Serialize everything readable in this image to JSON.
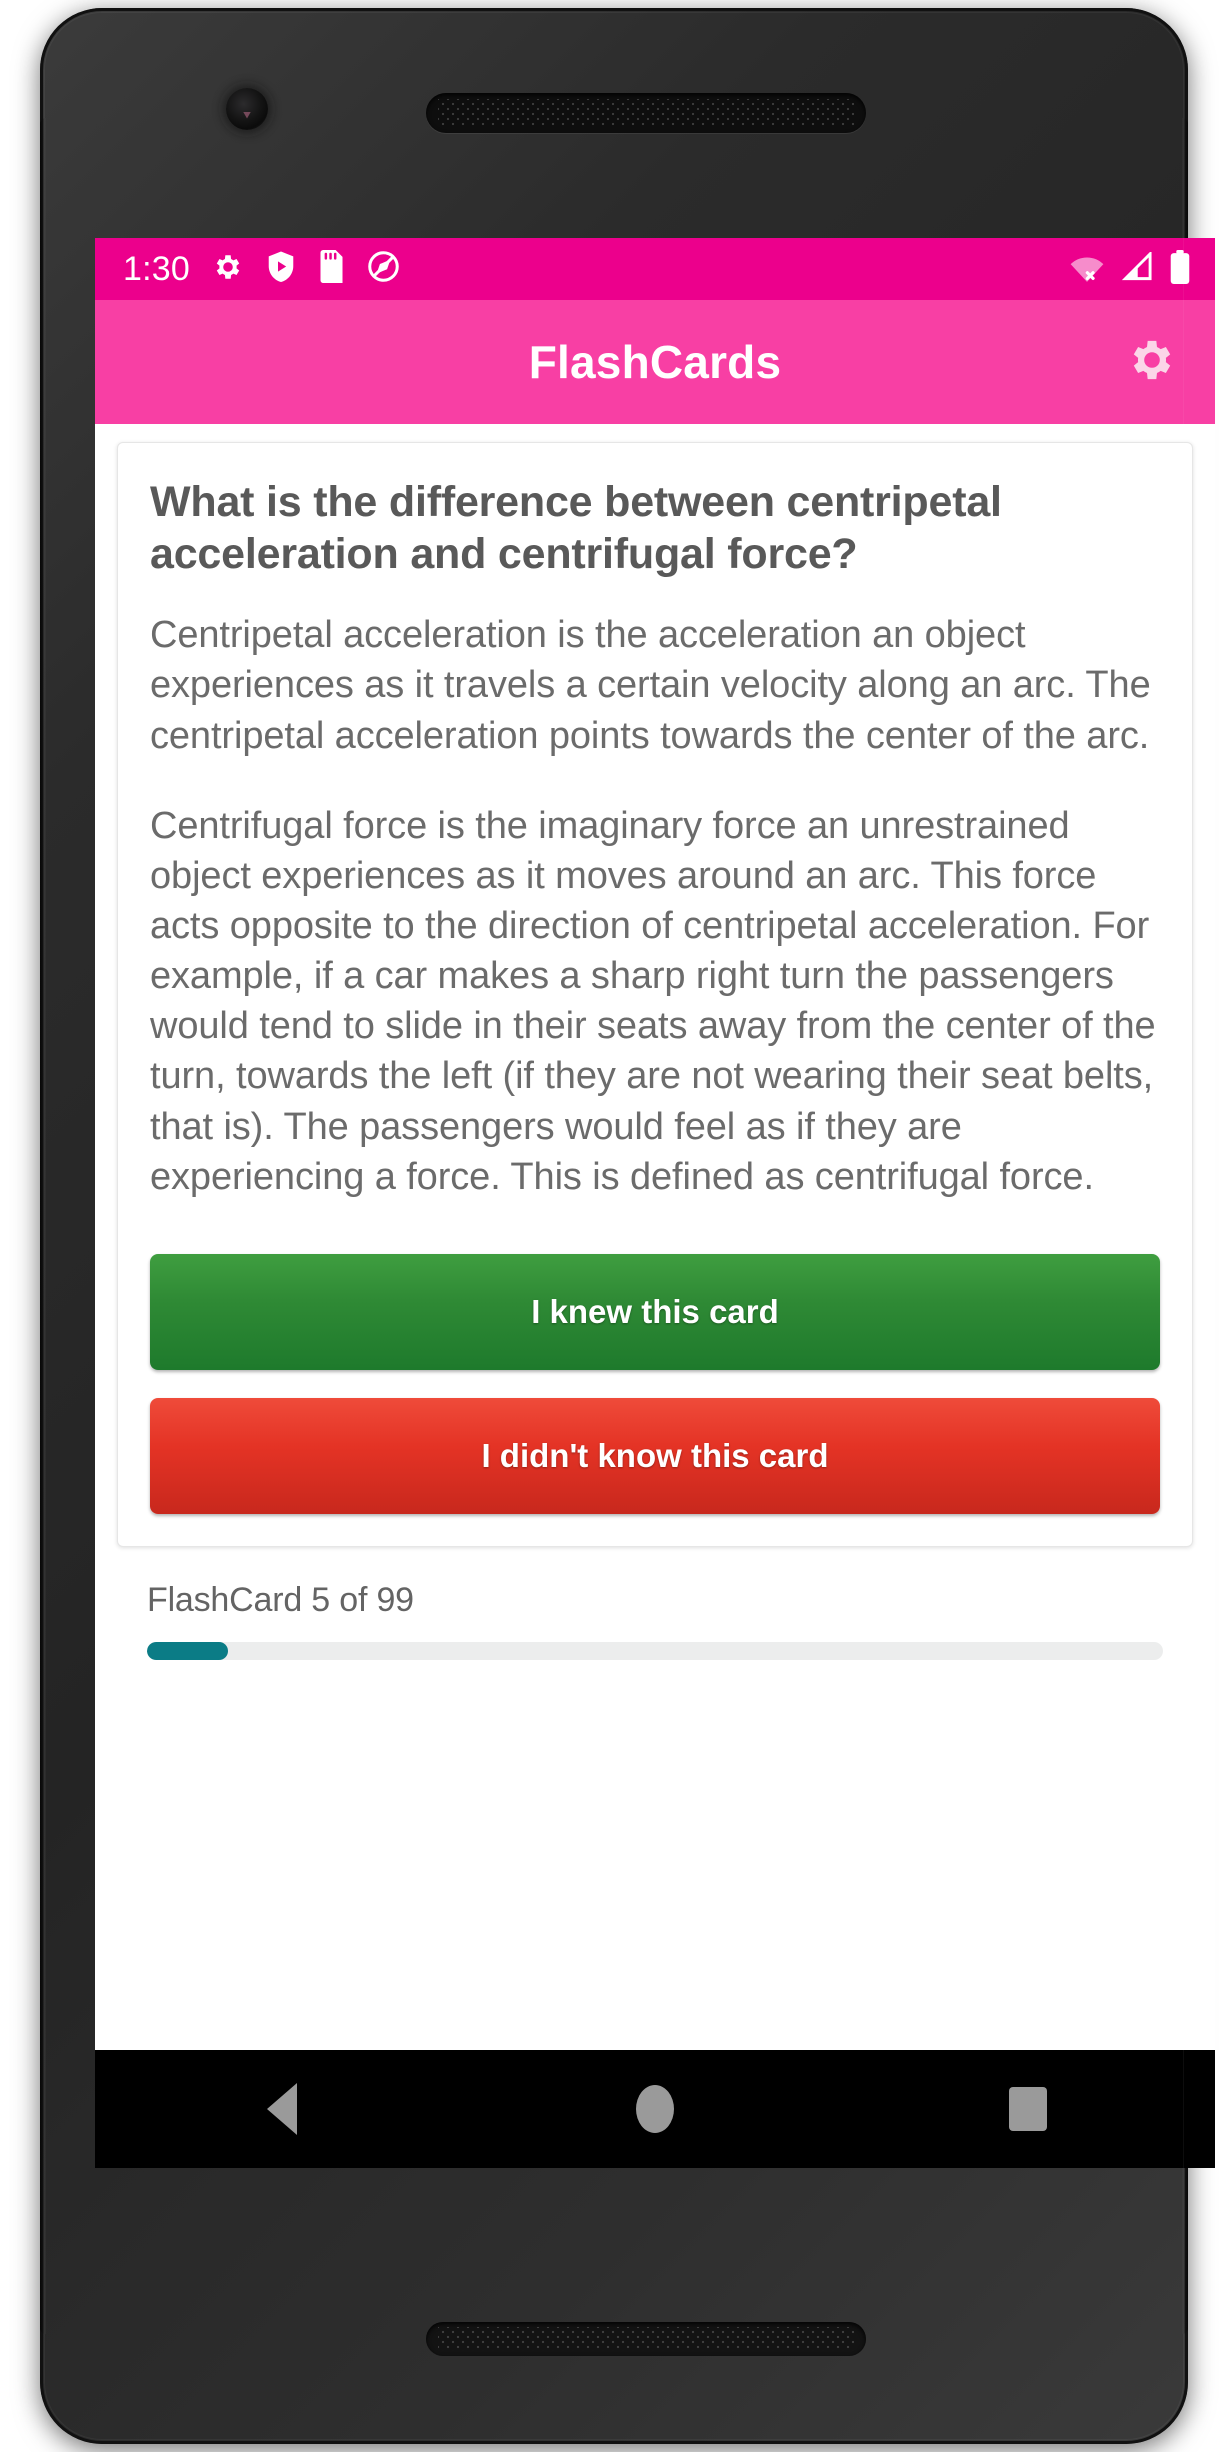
{
  "device": {
    "frame": "android-phone",
    "camera_icon": "front-camera",
    "speaker_icon": "earpiece-speaker"
  },
  "status_bar": {
    "clock": "1:30",
    "background": "#EC008C",
    "left_icons": [
      "gear-icon",
      "shield-play-icon",
      "sd-card-icon",
      "no-location-icon"
    ],
    "right_icons": [
      "wifi-off-icon",
      "cell-signal-icon",
      "battery-full-icon"
    ]
  },
  "app_bar": {
    "title": "FlashCards",
    "background": "#F83FA4",
    "settings_icon": "gear-icon"
  },
  "card": {
    "question": "What is the difference between centripetal acceleration and centrifugal force?",
    "answer_paragraphs": [
      "Centripetal acceleration is the acceleration an object experiences as it travels a certain velocity along an arc. The centripetal acceleration points towards the center of the arc.",
      "Centrifugal force is the imaginary force an unrestrained object experiences as it moves around an arc. This force acts opposite to the direction of centripetal acceleration. For example, if a car makes a sharp right turn the passengers would tend to slide in their seats away from the center of the turn, towards the left (if they are not wearing their seat belts, that is). The passengers would feel as if they are experiencing a force. This is defined as centrifugal force."
    ],
    "knew_button": "I knew this card",
    "didnt_know_button": "I didn't know this card",
    "knew_color": "#2f8a35",
    "didnt_know_color": "#e43325"
  },
  "footer": {
    "counter": "FlashCard 5 of 99",
    "current_card": 5,
    "total_cards": 99,
    "progress_percent": 8,
    "progress_color": "#0b7c86",
    "track_color": "#eceded"
  },
  "nav_bar": {
    "back": "back-triangle-icon",
    "home": "home-circle-icon",
    "recents": "recents-square-icon"
  }
}
